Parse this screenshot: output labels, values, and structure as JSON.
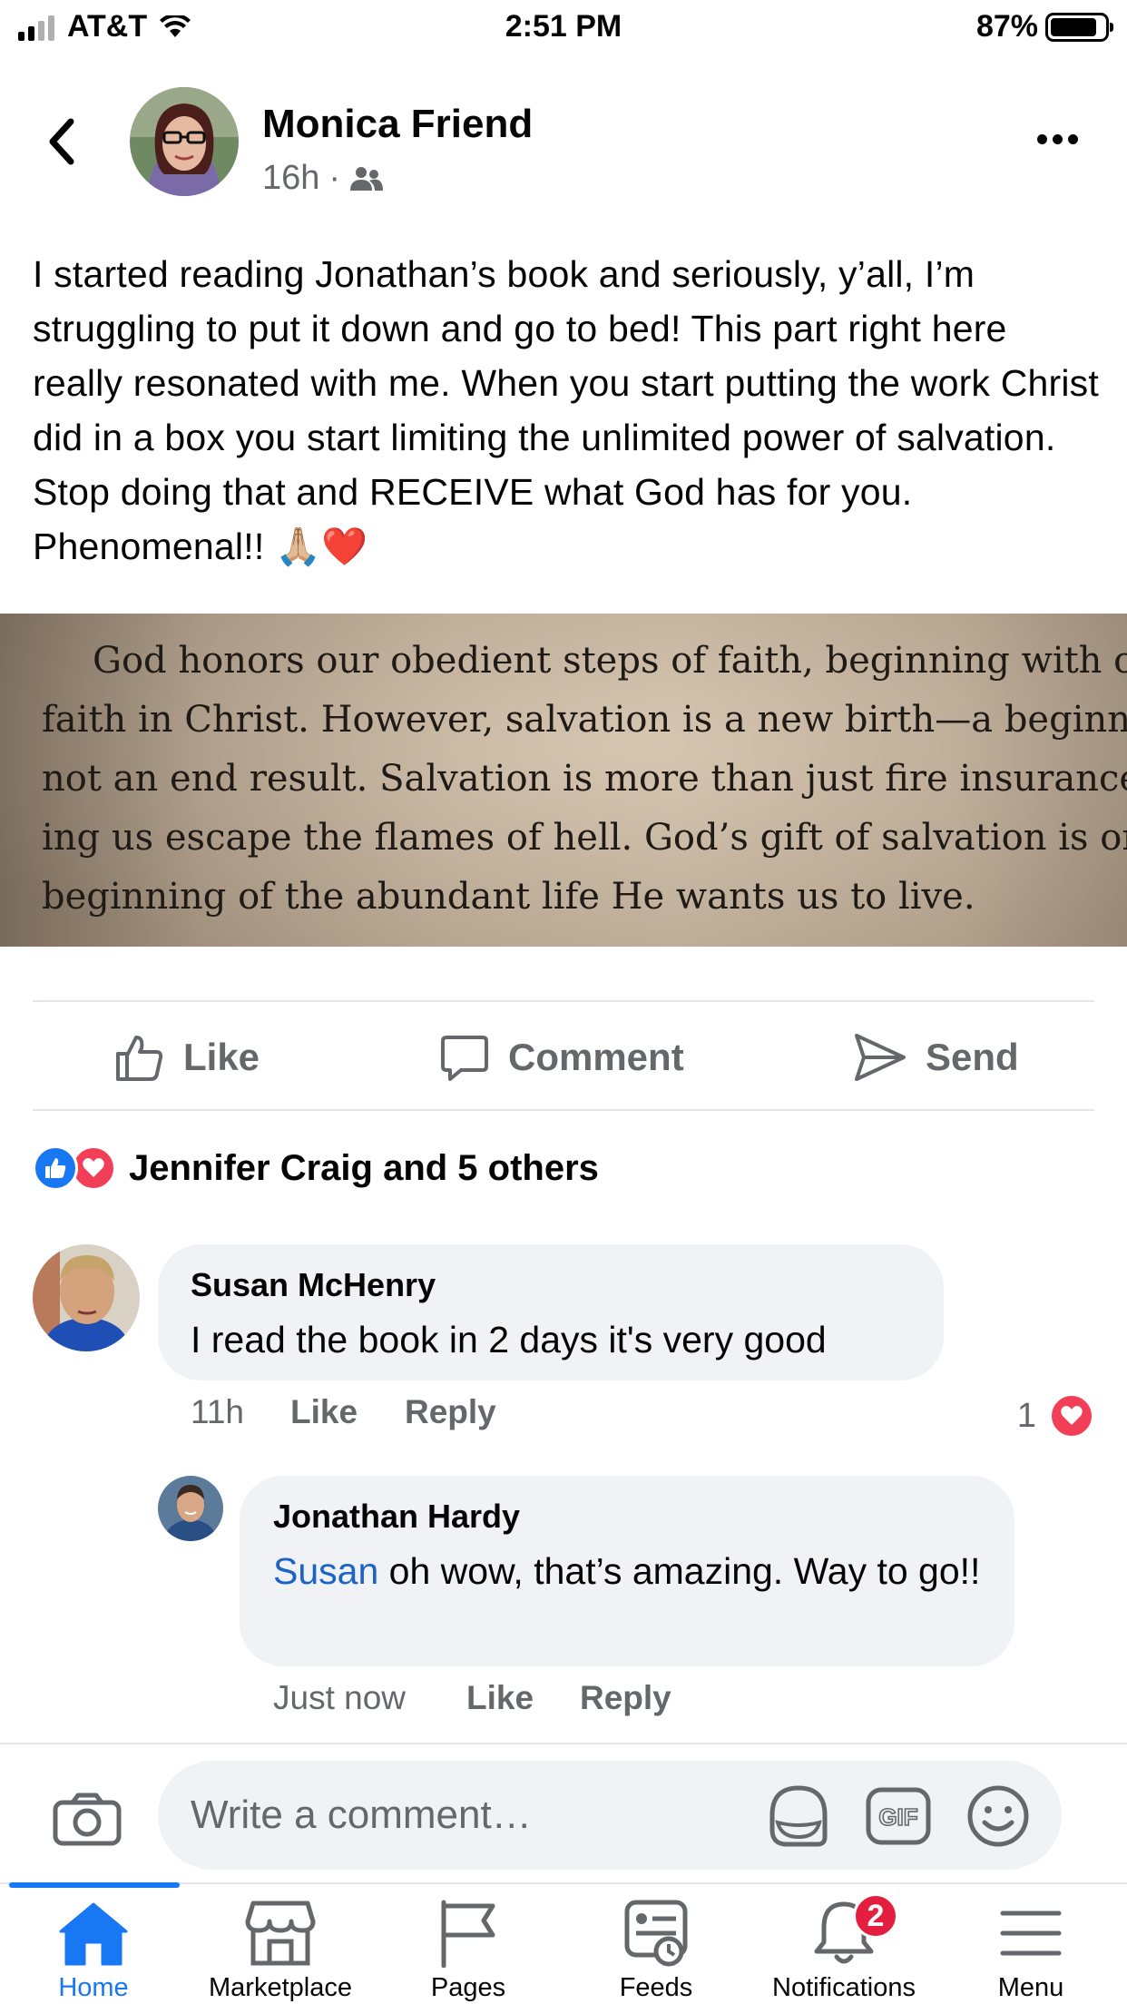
{
  "status_bar": {
    "carrier": "AT&T",
    "time": "2:51 PM",
    "battery_percent": "87%",
    "battery_level": 0.87,
    "signal_bars": 2
  },
  "post": {
    "author": "Monica Friend",
    "time_ago": "16h",
    "separator": "·",
    "audience_icon": "friends-icon",
    "text": "I started reading Jonathan’s book and seriously, y’all, I’m struggling to put it down and go to bed! This part right here really resonated with me. When you start putting the work Christ did in a box you start limiting the unlimited power of salvation. Stop doing that and RECEIVE what God has for you. Phenomenal!! 🙏🏼❤️",
    "image_lines": [
      "God honors our obedient steps of faith, beginning with our",
      "faith in Christ. However, salvation is a new birth—a beginning,",
      "not an end result. Salvation is more than just fire insurance, help-",
      "ing us escape the flames of hell. God’s gift of salvation is only the",
      "beginning of the abundant life He wants us to live."
    ]
  },
  "actions": {
    "like": "Like",
    "comment": "Comment",
    "send": "Send"
  },
  "reactions": {
    "summary": "Jennifer Craig and 5 others"
  },
  "comments": [
    {
      "author": "Susan McHenry",
      "text": "I read the book in 2 days it's very good",
      "time": "11h",
      "like": "Like",
      "reply": "Reply",
      "reaction_count": "1"
    },
    {
      "author": "Jonathan Hardy",
      "mention": "Susan",
      "text": " oh wow, that’s amazing. Way to go!!",
      "time": "Just now",
      "like": "Like",
      "reply": "Reply"
    }
  ],
  "comment_bar": {
    "placeholder": "Write a comment…",
    "gif_label": "GIF"
  },
  "tabs": [
    {
      "label": "Home",
      "icon": "home-icon",
      "active": true
    },
    {
      "label": "Marketplace",
      "icon": "marketplace-icon"
    },
    {
      "label": "Pages",
      "icon": "flag-icon"
    },
    {
      "label": "Feeds",
      "icon": "feeds-icon"
    },
    {
      "label": "Notifications",
      "icon": "bell-icon",
      "badge": "2"
    },
    {
      "label": "Menu",
      "icon": "menu-icon"
    }
  ],
  "colors": {
    "accent": "#1877f2",
    "love": "#f33e58",
    "badge": "#e41e3f",
    "mention": "#1c63c7",
    "secondary_text": "#65676b"
  }
}
